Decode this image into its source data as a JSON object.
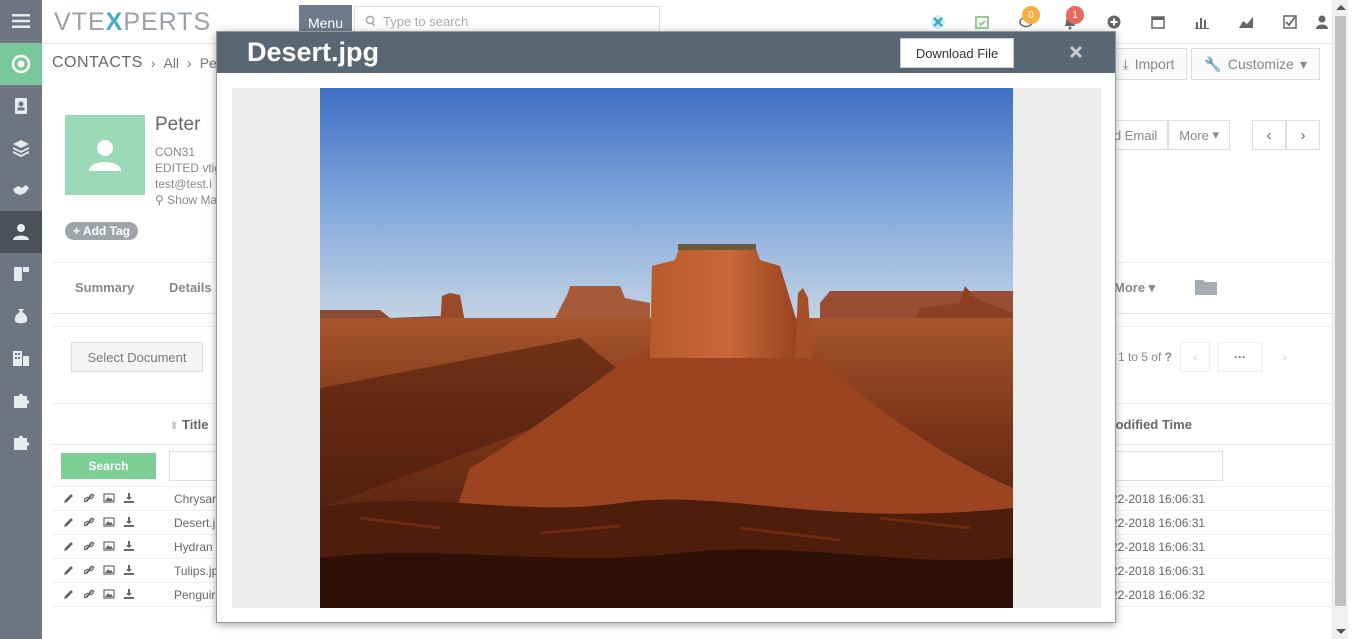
{
  "topbar": {
    "logo_text_a": "VTE",
    "logo_text_b": "X",
    "logo_text_c": "PERTS",
    "menu_label": "Menu",
    "search_placeholder": "Type to search",
    "badges": {
      "chat": "0",
      "notifications": "1"
    }
  },
  "breadcrumb": {
    "module": "CONTACTS",
    "filter": "All",
    "record": "Peter"
  },
  "header_actions": {
    "import": "Import",
    "customize": "Customize"
  },
  "record": {
    "name": "Peter",
    "number": "CON31",
    "edited": "EDITED vtig",
    "email": "test@test.i",
    "show_map": "Show Ma",
    "add_tag": "Add Tag",
    "send_email": "d Email",
    "more": "More"
  },
  "tabs": {
    "summary": "Summary",
    "details": "Details",
    "more": "More"
  },
  "related": {
    "select_document": "Select Document",
    "pager_text": "1 to 5  of",
    "pager_q": "?",
    "pager_dots": "···",
    "col_title": "Title",
    "col_modified": "lodified Time",
    "search_label": "Search",
    "rows": [
      {
        "title": "Chrysar",
        "time": "22-2018 16:06:31"
      },
      {
        "title": "Desert.j",
        "time": "22-2018 16:06:31"
      },
      {
        "title": "Hydran",
        "time": "22-2018 16:06:31"
      },
      {
        "title": "Tulips.jp",
        "time": "22-2018 16:06:31"
      },
      {
        "title": "Penguir",
        "time": "22-2018 16:06:32"
      }
    ]
  },
  "modal": {
    "title": "Desert.jpg",
    "download_label": "Download File"
  },
  "colors": {
    "sidebar": "#6f7580",
    "accent_green": "#79c89a",
    "modal_header": "#596775",
    "badge_orange": "#f5a623",
    "badge_red": "#e8685d"
  }
}
